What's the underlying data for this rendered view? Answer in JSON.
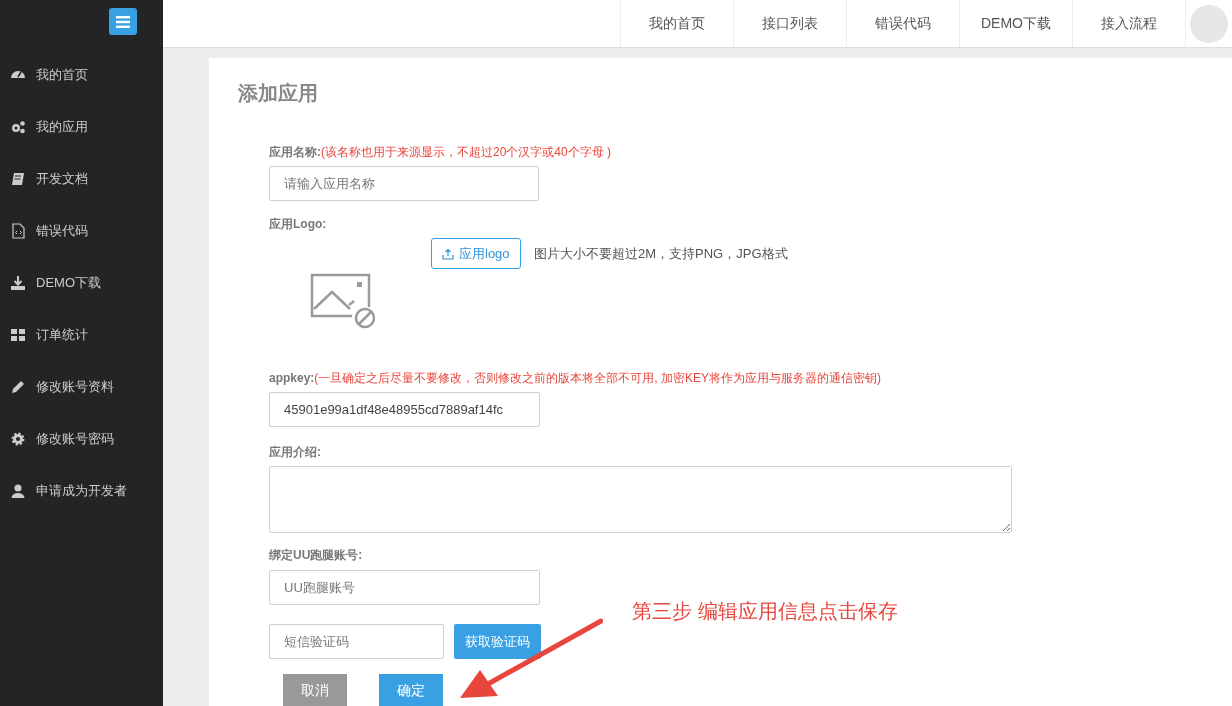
{
  "sidebar": {
    "items": [
      {
        "label": "我的首页"
      },
      {
        "label": "我的应用"
      },
      {
        "label": "开发文档"
      },
      {
        "label": "错误代码"
      },
      {
        "label": "DEMO下载"
      },
      {
        "label": "订单统计"
      },
      {
        "label": "修改账号资料"
      },
      {
        "label": "修改账号密码"
      },
      {
        "label": "申请成为开发者"
      }
    ]
  },
  "top_nav": [
    "我的首页",
    "接口列表",
    "错误代码",
    "DEMO下载",
    "接入流程"
  ],
  "page_title": "添加应用",
  "form": {
    "name": {
      "label": "应用名称:",
      "note": "(该名称也用于来源显示，不超过20个汉字或40个字母 )",
      "placeholder": "请输入应用名称"
    },
    "logo": {
      "label": "应用Logo:",
      "button": "应用logo",
      "hint": "图片大小不要超过2M，支持PNG，JPG格式"
    },
    "appkey": {
      "label": "appkey:",
      "note": "(一旦确定之后尽量不要修改，否则修改之前的版本将全部不可用, 加密KEY将作为应用与服务器的通信密钥)",
      "value": "45901e99a1df48e48955cd7889af14fc"
    },
    "intro": {
      "label": "应用介绍:"
    },
    "account": {
      "label": "绑定UU跑腿账号:",
      "placeholder": "UU跑腿账号"
    },
    "sms": {
      "placeholder": "短信验证码",
      "button": "获取验证码"
    },
    "cancel": "取消",
    "submit": "确定"
  },
  "annotation": "第三步 编辑应用信息点击保存"
}
